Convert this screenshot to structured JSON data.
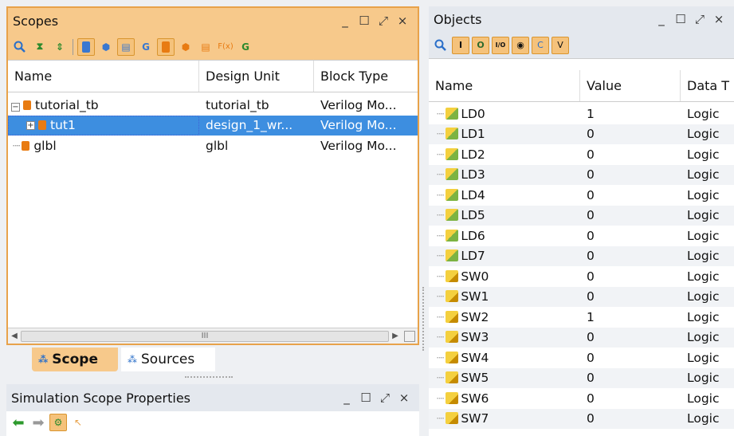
{
  "scopes": {
    "title": "Scopes",
    "columns": [
      "Name",
      "Design Unit",
      "Block Type"
    ],
    "rows": [
      {
        "name": "tutorial_tb",
        "unit": "tutorial_tb",
        "type": "Verilog Mo..."
      },
      {
        "name": "tut1",
        "unit": "design_1_wr...",
        "type": "Verilog Mo..."
      },
      {
        "name": "glbl",
        "unit": "glbl",
        "type": "Verilog Mo..."
      }
    ],
    "scroll_grip": "III"
  },
  "tabs": {
    "scope": "Scope",
    "sources": "Sources"
  },
  "props": {
    "title": "Simulation Scope Properties"
  },
  "objects": {
    "title": "Objects",
    "columns": [
      "Name",
      "Value",
      "Data T"
    ],
    "rows": [
      {
        "name": "LD0",
        "value": "1",
        "type": "Logic",
        "kind": "out"
      },
      {
        "name": "LD1",
        "value": "0",
        "type": "Logic",
        "kind": "out"
      },
      {
        "name": "LD2",
        "value": "0",
        "type": "Logic",
        "kind": "out"
      },
      {
        "name": "LD3",
        "value": "0",
        "type": "Logic",
        "kind": "out"
      },
      {
        "name": "LD4",
        "value": "0",
        "type": "Logic",
        "kind": "out"
      },
      {
        "name": "LD5",
        "value": "0",
        "type": "Logic",
        "kind": "out"
      },
      {
        "name": "LD6",
        "value": "0",
        "type": "Logic",
        "kind": "out"
      },
      {
        "name": "LD7",
        "value": "0",
        "type": "Logic",
        "kind": "out"
      },
      {
        "name": "SW0",
        "value": "0",
        "type": "Logic",
        "kind": "in"
      },
      {
        "name": "SW1",
        "value": "0",
        "type": "Logic",
        "kind": "in"
      },
      {
        "name": "SW2",
        "value": "1",
        "type": "Logic",
        "kind": "in"
      },
      {
        "name": "SW3",
        "value": "0",
        "type": "Logic",
        "kind": "in"
      },
      {
        "name": "SW4",
        "value": "0",
        "type": "Logic",
        "kind": "in"
      },
      {
        "name": "SW5",
        "value": "0",
        "type": "Logic",
        "kind": "in"
      },
      {
        "name": "SW6",
        "value": "0",
        "type": "Logic",
        "kind": "in"
      },
      {
        "name": "SW7",
        "value": "0",
        "type": "Logic",
        "kind": "in"
      }
    ]
  },
  "window_controls": {
    "minimize": "_",
    "maximize": "☐",
    "float": "⤢",
    "close": "×"
  },
  "colors": {
    "active_title": "#f7c98b",
    "selection": "#3d8ee0",
    "accent": "#e87b12"
  }
}
